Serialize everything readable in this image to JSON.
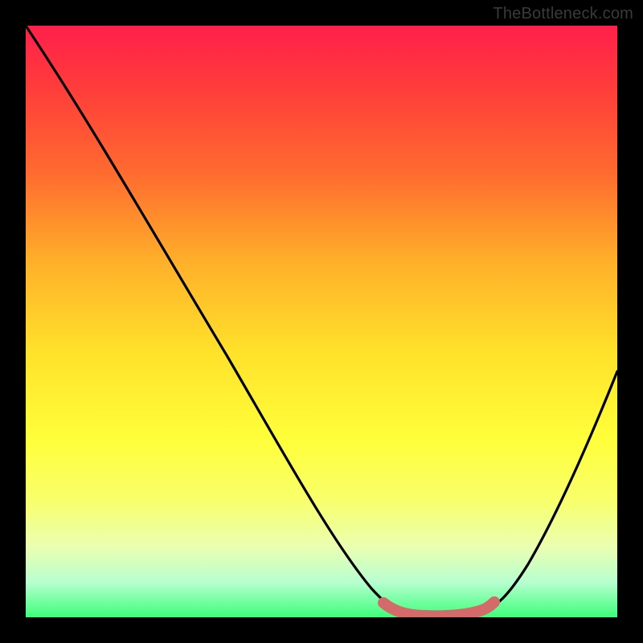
{
  "watermark": "TheBottleneck.com",
  "chart_data": {
    "type": "line",
    "title": "",
    "xlabel": "",
    "ylabel": "",
    "xlim": [
      0,
      100
    ],
    "ylim": [
      0,
      100
    ],
    "series": [
      {
        "name": "bottleneck-curve",
        "x": [
          0,
          6,
          12,
          18,
          24,
          30,
          36,
          42,
          48,
          54,
          58,
          62,
          66,
          70,
          74,
          78,
          82,
          86,
          90,
          94,
          100
        ],
        "y": [
          100,
          92,
          84,
          76,
          67,
          58,
          49,
          40,
          31,
          20,
          12,
          6,
          2,
          0,
          0,
          2,
          8,
          16,
          26,
          38,
          55
        ]
      }
    ],
    "highlight": {
      "name": "optimal-region",
      "x": [
        60,
        78
      ],
      "y": [
        0,
        0
      ],
      "color": "#d46a6a"
    },
    "gradient_stops": [
      {
        "pos": 0,
        "color": "#ff1f4b"
      },
      {
        "pos": 25,
        "color": "#ff6b2f"
      },
      {
        "pos": 55,
        "color": "#ffe12a"
      },
      {
        "pos": 80,
        "color": "#f8ff6a"
      },
      {
        "pos": 100,
        "color": "#3cff7a"
      }
    ]
  }
}
